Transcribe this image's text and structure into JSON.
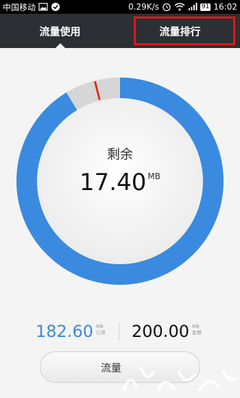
{
  "status_bar": {
    "carrier": "中国移动",
    "speed": "0.29K/s",
    "battery": "91",
    "time": "16:02",
    "icons": [
      "image-icon",
      "check-icon",
      "alarm-icon",
      "wifi-icon",
      "signal-icon",
      "battery-icon"
    ]
  },
  "tabs": [
    {
      "label": "流量使用",
      "active": true
    },
    {
      "label": "流量排行",
      "active": false
    }
  ],
  "gauge": {
    "label": "剩余",
    "value": "17.40",
    "unit": "MB",
    "remaining_fraction": 0.087,
    "colors": {
      "used": "#3a8be0",
      "remaining": "#d6d6d6",
      "marker": "#e0301e"
    }
  },
  "stats": {
    "used_value": "182.60",
    "used_unit": "MB",
    "used_tag": "已用",
    "plan_value": "200.00",
    "plan_unit": "MB",
    "plan_tag": "套餐"
  },
  "bottom_button": {
    "label": "流量"
  },
  "annotation": {
    "color": "#e01818"
  }
}
